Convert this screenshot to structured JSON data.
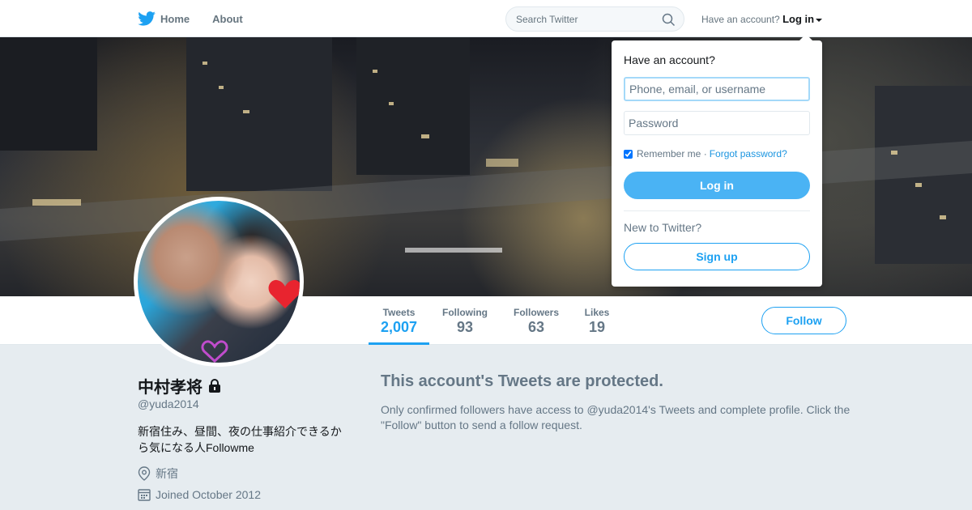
{
  "nav": {
    "home_label": "Home",
    "about_label": "About",
    "search_placeholder": "Search Twitter",
    "have_account": "Have an account?",
    "login_label": "Log in"
  },
  "profile": {
    "name": "中村孝将",
    "handle": "@yuda2014",
    "bio": "新宿住み、昼間、夜の仕事紹介できるから気になる人Followme",
    "location": "新宿",
    "joined": "Joined October 2012",
    "follow_label": "Follow"
  },
  "stats": [
    {
      "label": "Tweets",
      "value": "2,007"
    },
    {
      "label": "Following",
      "value": "93"
    },
    {
      "label": "Followers",
      "value": "63"
    },
    {
      "label": "Likes",
      "value": "19"
    }
  ],
  "protected": {
    "title": "This account's Tweets are protected.",
    "text": "Only confirmed followers have access to @yuda2014's Tweets and complete profile. Click the \"Follow\" button to send a follow request."
  },
  "login_dropdown": {
    "title": "Have an account?",
    "username_placeholder": "Phone, email, or username",
    "password_placeholder": "Password",
    "remember_label": "Remember me",
    "separator": "·",
    "forgot_label": "Forgot password?",
    "login_button": "Log in",
    "new_label": "New to Twitter?",
    "signup_button": "Sign up"
  },
  "colors": {
    "accent": "#1da1f2",
    "button_blue": "#4ab3f4",
    "muted": "#657786",
    "background": "#e6ecf0"
  },
  "icons": [
    "twitter-bird-icon",
    "home-icon",
    "search-icon",
    "lock-icon",
    "location-icon",
    "calendar-icon"
  ]
}
